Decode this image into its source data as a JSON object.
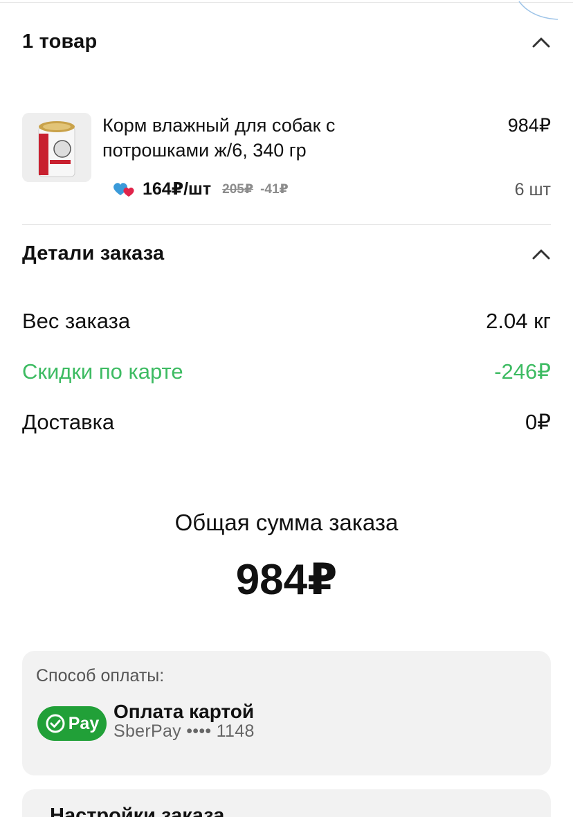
{
  "items_section": {
    "title": "1 товар"
  },
  "product": {
    "name": "Корм влажный для собак с потрошками ж/6, 340 гр",
    "price": "984₽",
    "unit_price": "164₽/шт",
    "old_price": "205₽",
    "discount": "-41₽",
    "quantity": "6 шт"
  },
  "details_section": {
    "title": "Детали заказа",
    "rows": [
      {
        "label": "Вес заказа",
        "value": "2.04 кг"
      },
      {
        "label": "Скидки по карте",
        "value": "-246₽"
      },
      {
        "label": "Доставка",
        "value": "0₽"
      }
    ]
  },
  "total": {
    "label": "Общая сумма заказа",
    "value": "984₽"
  },
  "payment": {
    "caption": "Способ оплаты:",
    "badge_text": "Pay",
    "method": "Оплата картой",
    "card": "SberPay •••• 1148"
  },
  "settings": {
    "title": "Настройки заказа"
  },
  "colors": {
    "accent_green": "#3dbb62",
    "sber_green": "#21a038"
  },
  "icons": {
    "collapse": "chevron-up-icon",
    "loyalty": "hearts-icon",
    "sberpay": "check-circle-icon"
  }
}
